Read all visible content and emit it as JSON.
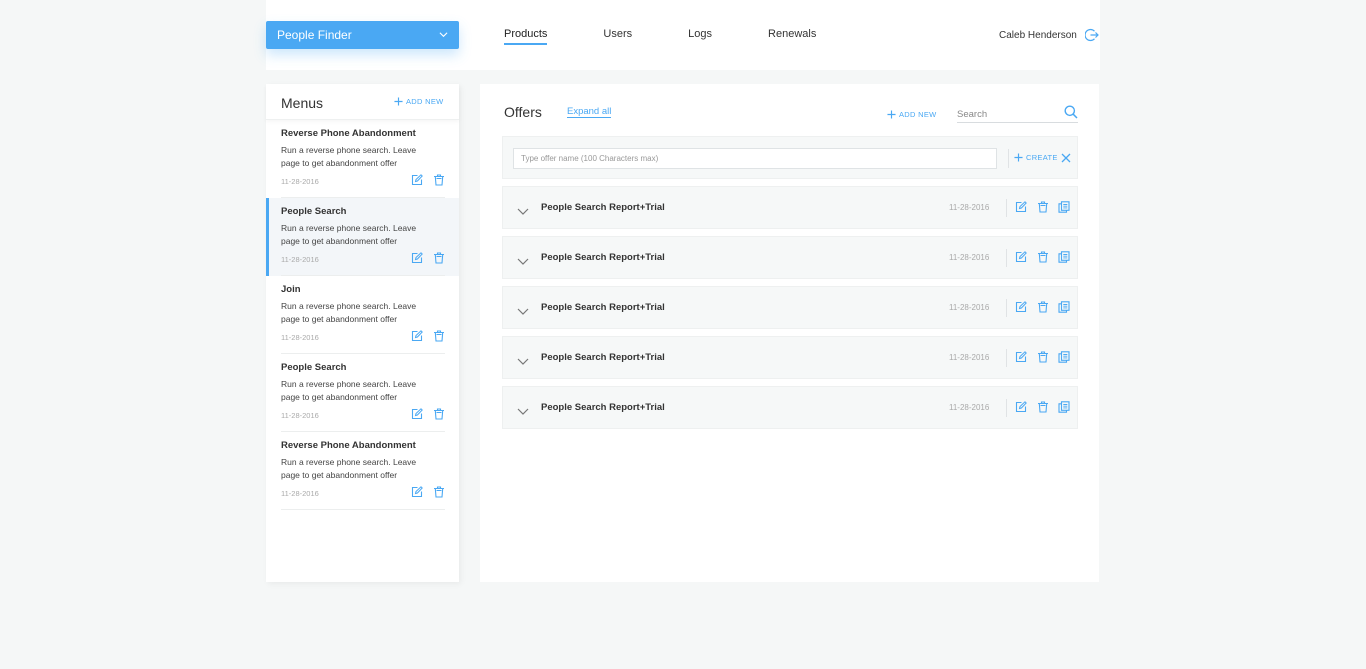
{
  "header": {
    "app_select": "People Finder",
    "nav": [
      "Products",
      "Users",
      "Logs",
      "Renewals"
    ],
    "active_nav": "Products",
    "user_name": "Caleb Henderson"
  },
  "sidebar": {
    "title": "Menus",
    "add_new": "ADD NEW",
    "items": [
      {
        "title": "Reverse Phone Abandonment",
        "desc": "Run a reverse phone search. Leave page to get abandonment offer",
        "date": "11-28-2016",
        "selected": false
      },
      {
        "title": "People Search",
        "desc": "Run a reverse phone search. Leave page to get abandonment offer",
        "date": "11-28-2016",
        "selected": true
      },
      {
        "title": "Join",
        "desc": "Run a reverse phone search. Leave page to get abandonment offer",
        "date": "11-28-2016",
        "selected": false
      },
      {
        "title": "People Search",
        "desc": "Run a reverse phone search. Leave page to get abandonment offer",
        "date": "11-28-2016",
        "selected": false
      },
      {
        "title": "Reverse Phone Abandonment",
        "desc": "Run a reverse phone search. Leave page to get abandonment offer",
        "date": "11-28-2016",
        "selected": false
      }
    ]
  },
  "main": {
    "title": "Offers",
    "expand_all": "Expand all",
    "add_new": "ADD NEW",
    "search_placeholder": "Search",
    "create_placeholder": "Type offer name (100 Characters max)",
    "create_label": "CREATE",
    "offers": [
      {
        "name": "People Search Report+Trial",
        "date": "11-28-2016"
      },
      {
        "name": "People Search Report+Trial",
        "date": "11-28-2016"
      },
      {
        "name": "People Search Report+Trial",
        "date": "11-28-2016"
      },
      {
        "name": "People Search Report+Trial",
        "date": "11-28-2016"
      },
      {
        "name": "People Search Report+Trial",
        "date": "11-28-2016"
      }
    ]
  },
  "icons": {
    "chevron": "chevron-down-icon",
    "logout": "logout-icon",
    "search": "search-icon",
    "edit": "edit-icon",
    "delete": "trash-icon",
    "copy": "copy-icon",
    "plus": "plus-icon",
    "close": "close-icon"
  },
  "colors": {
    "accent": "#4aa8f3",
    "background": "#f5f7f7",
    "row": "#f6f8f8"
  }
}
